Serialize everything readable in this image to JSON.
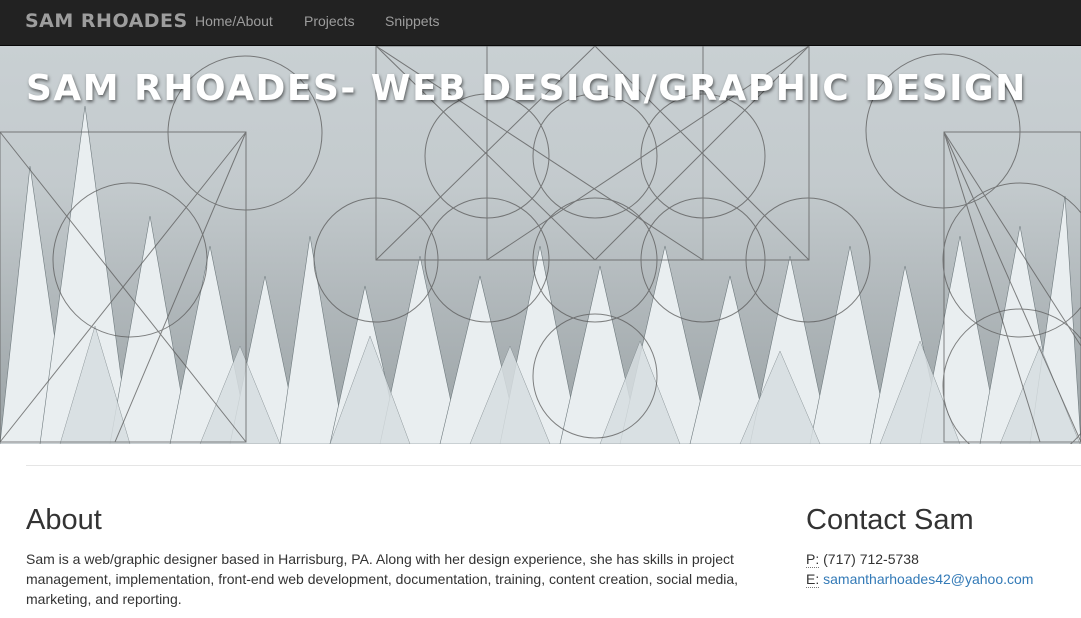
{
  "navbar": {
    "brand": "SAM RHOADES",
    "links": [
      "Home/About",
      "Projects",
      "Snippets"
    ]
  },
  "hero": {
    "title": "SAM RHOADES- WEB DESIGN/GRAPHIC DESIGN",
    "background": "snowy pine forest with geometric line overlay"
  },
  "about": {
    "heading": "About",
    "text": "Sam is a web/graphic designer based in Harrisburg, PA. Along with her design experience, she has skills in project management, implementation, front-end web development, documentation, training, content creation, social media, marketing, and reporting."
  },
  "contact": {
    "heading": "Contact Sam",
    "phone_label": "P:",
    "phone": "(717) 712-5738",
    "email_label": "E:",
    "email": "samantharhoades42@yahoo.com"
  },
  "colors": {
    "navbar_bg": "#222222",
    "nav_text": "#9d9d9d",
    "link": "#337ab7"
  }
}
